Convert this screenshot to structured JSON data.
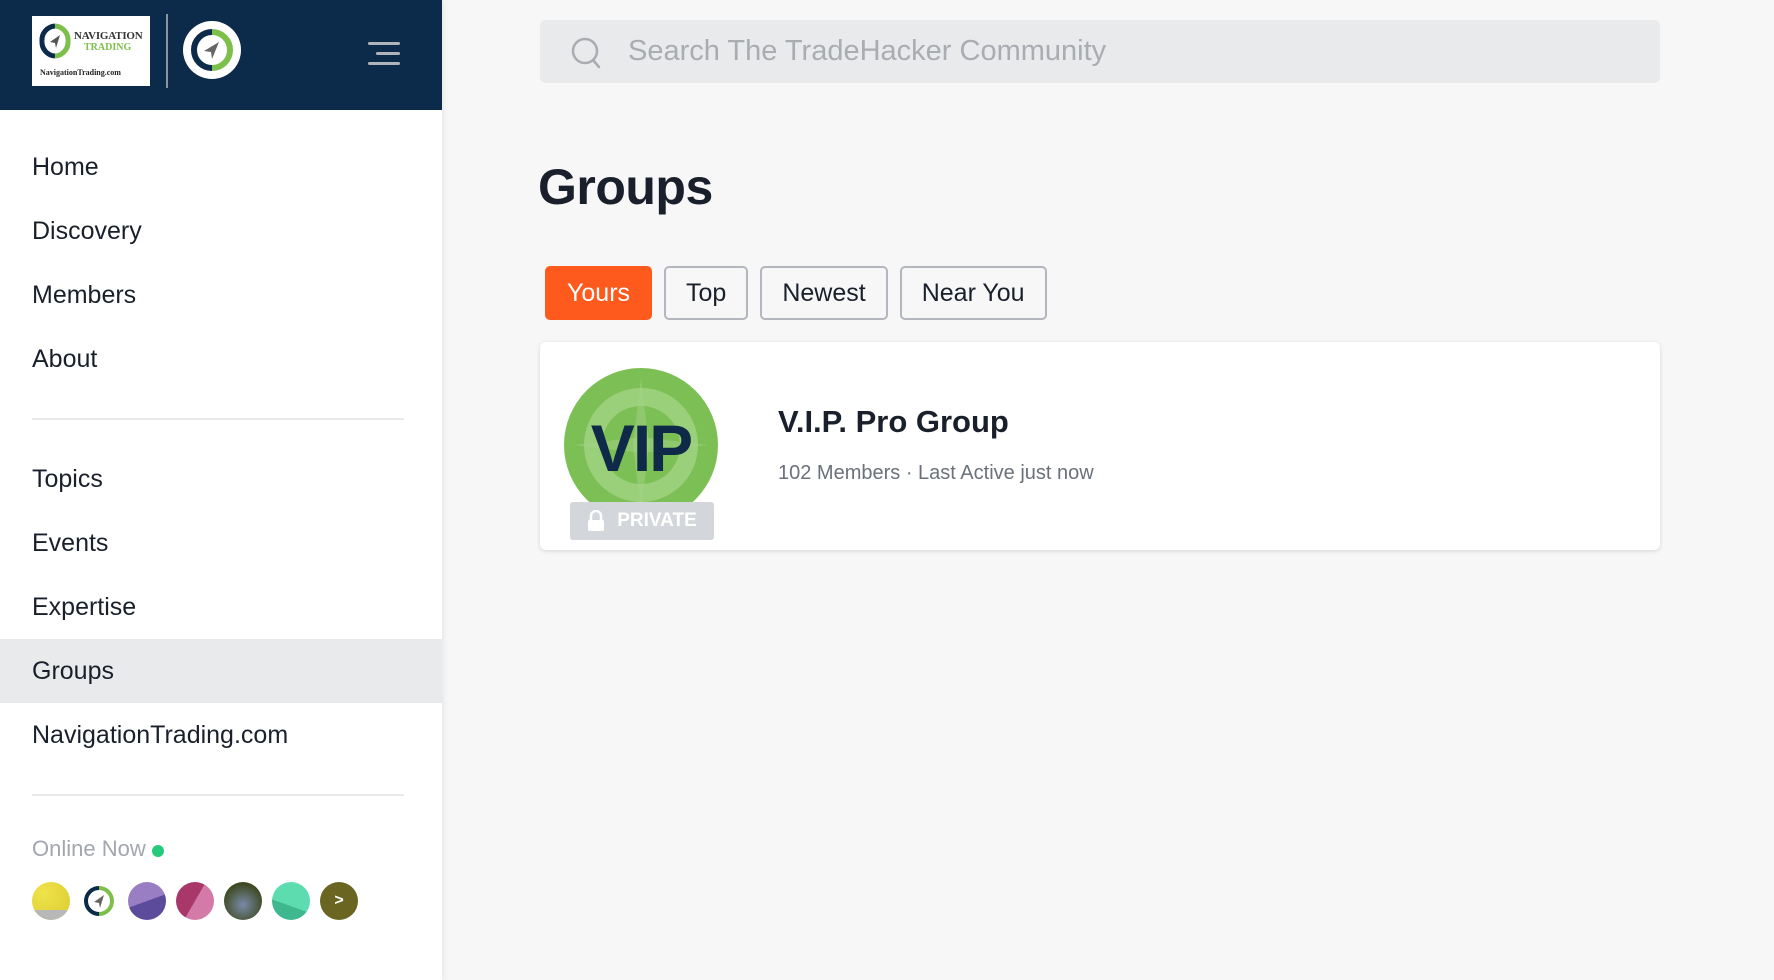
{
  "sidebar": {
    "logo": {
      "name_line1": "NAVIGATION",
      "name_line2": "TRADING",
      "url": "NavigationTrading.com"
    },
    "nav_primary": [
      {
        "label": "Home"
      },
      {
        "label": "Discovery"
      },
      {
        "label": "Members"
      },
      {
        "label": "About"
      }
    ],
    "nav_secondary": [
      {
        "label": "Topics"
      },
      {
        "label": "Events"
      },
      {
        "label": "Expertise"
      },
      {
        "label": "Groups",
        "active": true
      },
      {
        "label": "NavigationTrading.com"
      }
    ],
    "online": {
      "label": "Online Now",
      "status_color": "#27c97a",
      "avatars": [
        {
          "name": "member-avatar-1",
          "color": "#e8dc3a"
        },
        {
          "name": "member-avatar-2",
          "color": "#ffffff"
        },
        {
          "name": "member-avatar-3",
          "color": "#9a7ec4"
        },
        {
          "name": "member-avatar-4",
          "color": "#c4507e"
        },
        {
          "name": "member-avatar-5",
          "color": "#4e5a2e"
        },
        {
          "name": "member-avatar-6",
          "color": "#5ddcb0"
        }
      ],
      "more_label": ">"
    }
  },
  "search": {
    "placeholder": "Search The TradeHacker Community",
    "value": ""
  },
  "main": {
    "title": "Groups",
    "tabs": [
      {
        "label": "Yours",
        "active": true
      },
      {
        "label": "Top"
      },
      {
        "label": "Newest"
      },
      {
        "label": "Near You"
      }
    ],
    "groups": [
      {
        "logo_text": "VIP",
        "name": "V.I.P. Pro Group",
        "meta": "102 Members · Last Active just now",
        "badge": "PRIVATE"
      }
    ]
  },
  "colors": {
    "header_bg": "#0c2a4a",
    "accent": "#fe5a1e",
    "active_nav_bg": "#e9eaec"
  }
}
